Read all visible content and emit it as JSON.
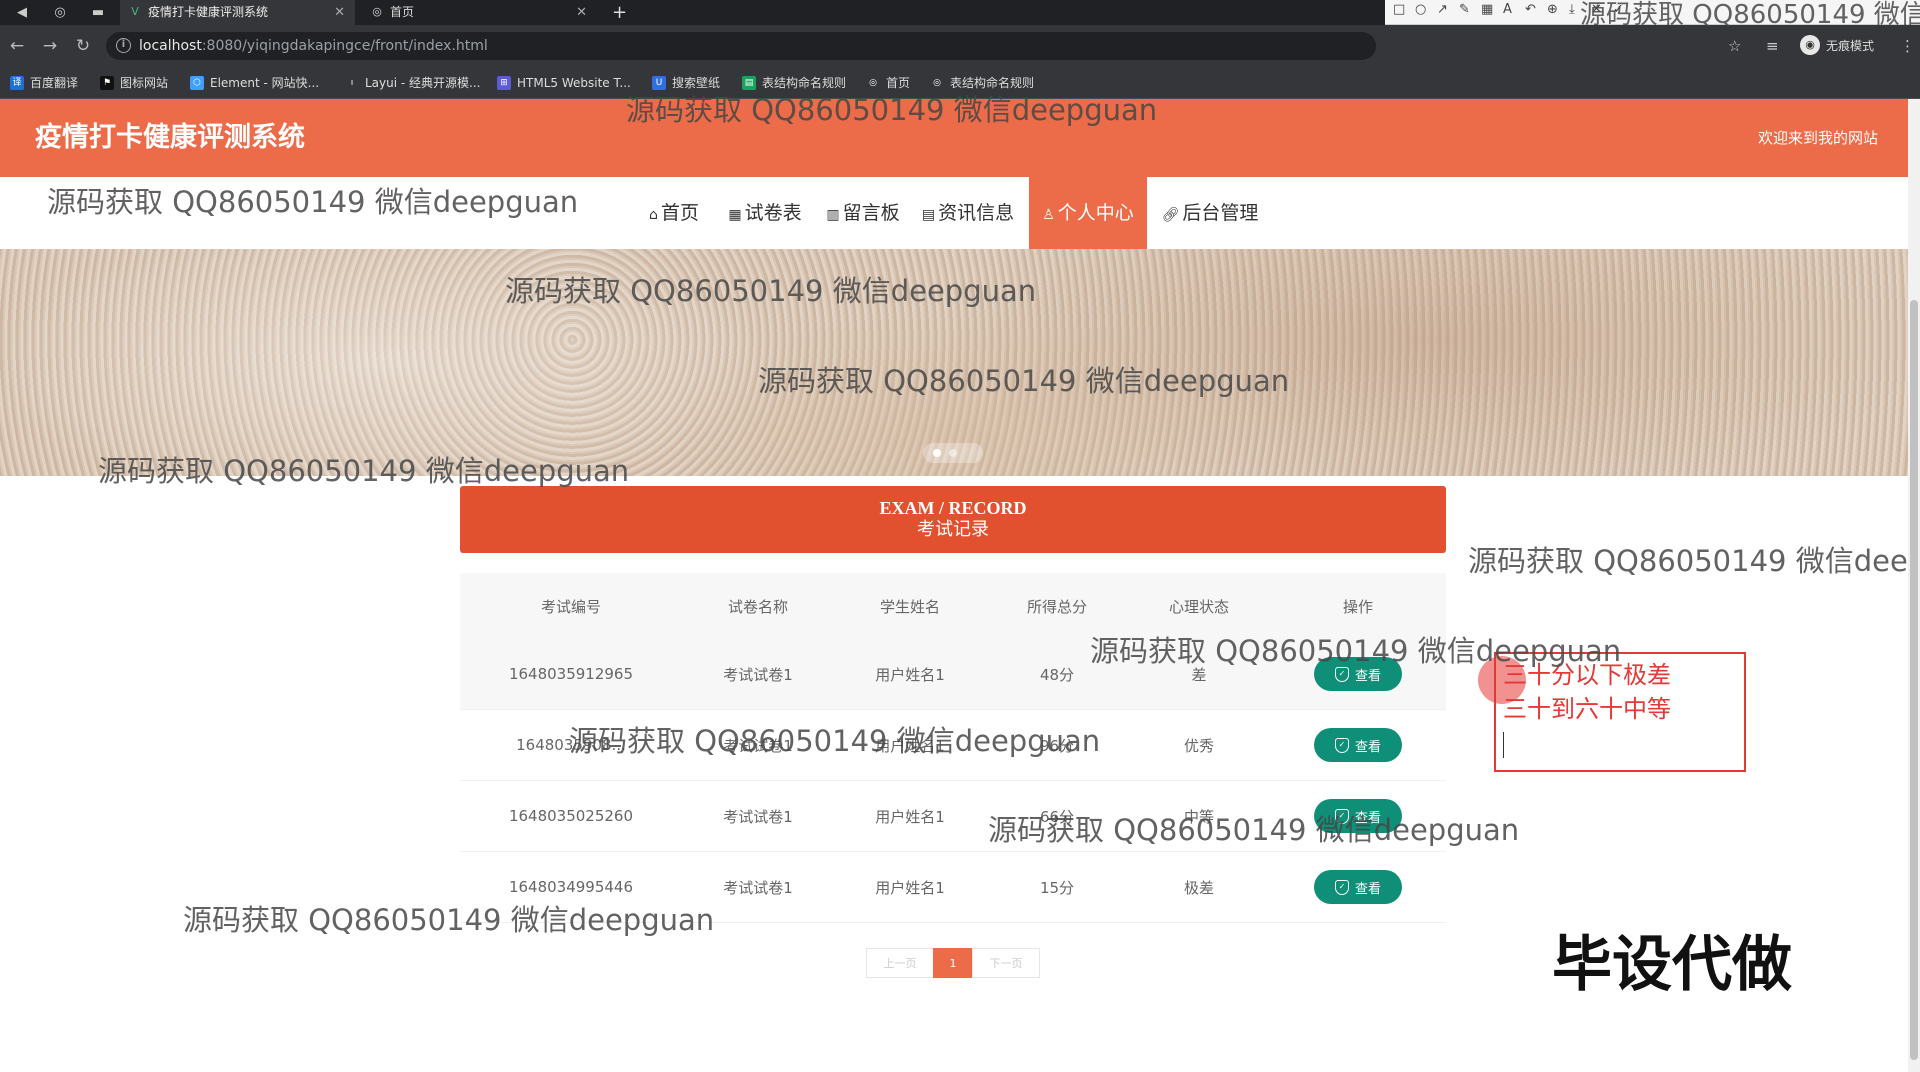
{
  "browser": {
    "tabs": [
      {
        "title": "疫情打卡健康评测系统",
        "icon": "vue-icon",
        "active": true
      },
      {
        "title": "首页",
        "icon": "globe-icon",
        "active": false
      }
    ],
    "url_host": "localhost",
    "url_path": ":8080/yiqingdakapingce/front/index.html",
    "incognito_label": "无痕模式",
    "bookmarks": [
      "百度翻译",
      "图标网站",
      "Element - 网站快...",
      "Layui - 经典开源模...",
      "HTML5 Website T...",
      "搜索壁纸",
      "表结构命名规则",
      "首页",
      "表结构命名规则"
    ]
  },
  "snip_tool": {
    "font_size": "20",
    "colors": [
      "#ff2020",
      "#000000",
      "#7f7f7f",
      "#880015",
      "#ff7f27",
      "#22b14c",
      "#3f48cc",
      "#a349a4",
      "#ffffff",
      "#c3c3c3",
      "#b97a57",
      "#ffc90e",
      "#b5e61d",
      "#00a2e8",
      "#c8bfe7",
      "#22cccc"
    ]
  },
  "header": {
    "title": "疫情打卡健康评测系统",
    "welcome": "欢迎来到我的网站"
  },
  "nav": {
    "items": [
      {
        "label": "首页",
        "icon": "home-icon"
      },
      {
        "label": "试卷表",
        "icon": "grid-icon"
      },
      {
        "label": "留言板",
        "icon": "board-icon"
      },
      {
        "label": "资讯信息",
        "icon": "news-icon"
      },
      {
        "label": "个人中心",
        "icon": "user-icon",
        "active": true
      },
      {
        "label": "后台管理",
        "icon": "link-icon"
      }
    ]
  },
  "exam": {
    "title_en": "EXAM / RECORD",
    "title_cn": "考试记录",
    "columns": [
      "考试编号",
      "试卷名称",
      "学生姓名",
      "所得总分",
      "心理状态",
      "操作"
    ],
    "rows": [
      {
        "id": "1648035912965",
        "paper": "考试试卷1",
        "student": "用户姓名1",
        "score": "48分",
        "state": "差",
        "action": "查看"
      },
      {
        "id": "1648035908...",
        "paper": "考试试卷1",
        "student": "用户姓名1",
        "score": "96分",
        "state": "优秀",
        "action": "查看"
      },
      {
        "id": "1648035025260",
        "paper": "考试试卷1",
        "student": "用户姓名1",
        "score": "66分",
        "state": "中等",
        "action": "查看"
      },
      {
        "id": "1648034995446",
        "paper": "考试试卷1",
        "student": "用户姓名1",
        "score": "15分",
        "state": "极差",
        "action": "查看"
      }
    ],
    "pagination": {
      "prev": "上一页",
      "current": "1",
      "next": "下一页"
    }
  },
  "annotation": {
    "lines": [
      "三十分以下极差",
      "三十到六十中等"
    ]
  },
  "stamp": "毕设代做",
  "watermark": "源码获取 QQ86050149 微信deepguan"
}
